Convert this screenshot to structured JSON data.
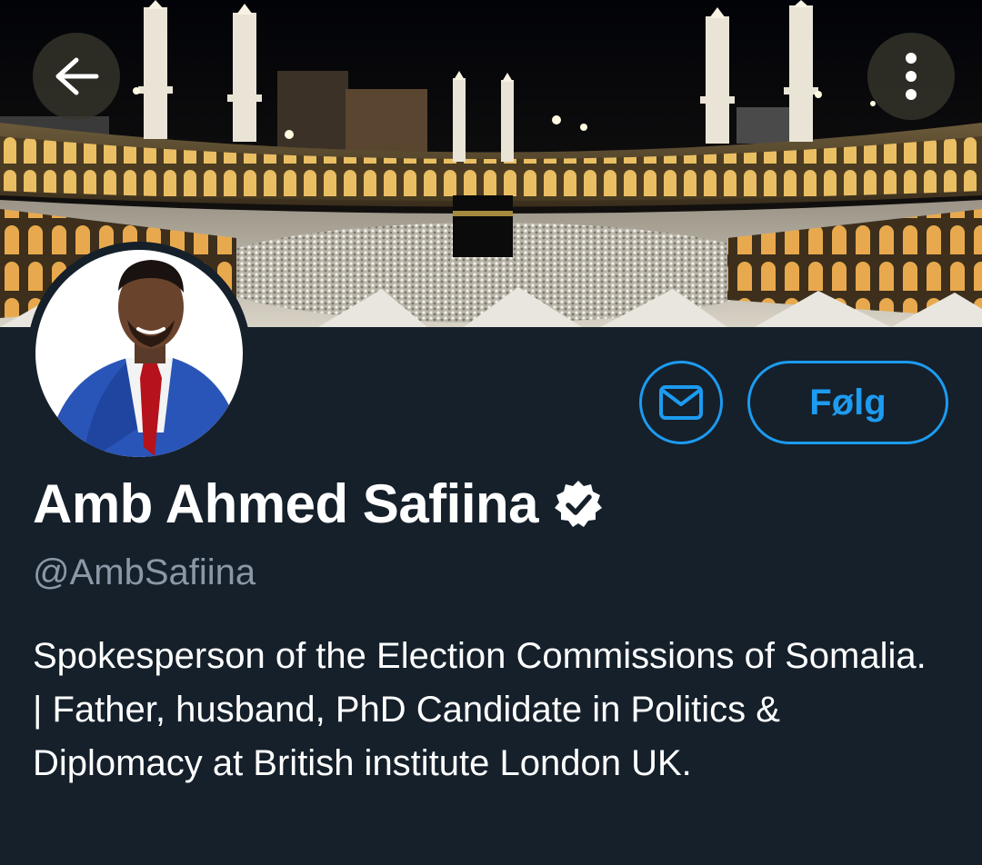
{
  "header": {
    "back_icon": "arrow-left-icon",
    "more_icon": "more-vertical-icon"
  },
  "profile": {
    "display_name": "Amb Ahmed Safiina",
    "handle": "@AmbSafiina",
    "verified_icon": "verified-badge-icon",
    "bio": "Spokesperson of the Election Commissions of Somalia. | Father, husband, PhD Candidate in Politics & Diplomacy at British institute London UK."
  },
  "actions": {
    "message_icon": "envelope-icon",
    "follow_label": "Følg"
  },
  "colors": {
    "background": "#15202b",
    "accent": "#1d9bf0",
    "secondary_text": "#8b98a5",
    "primary_text": "#ffffff"
  }
}
